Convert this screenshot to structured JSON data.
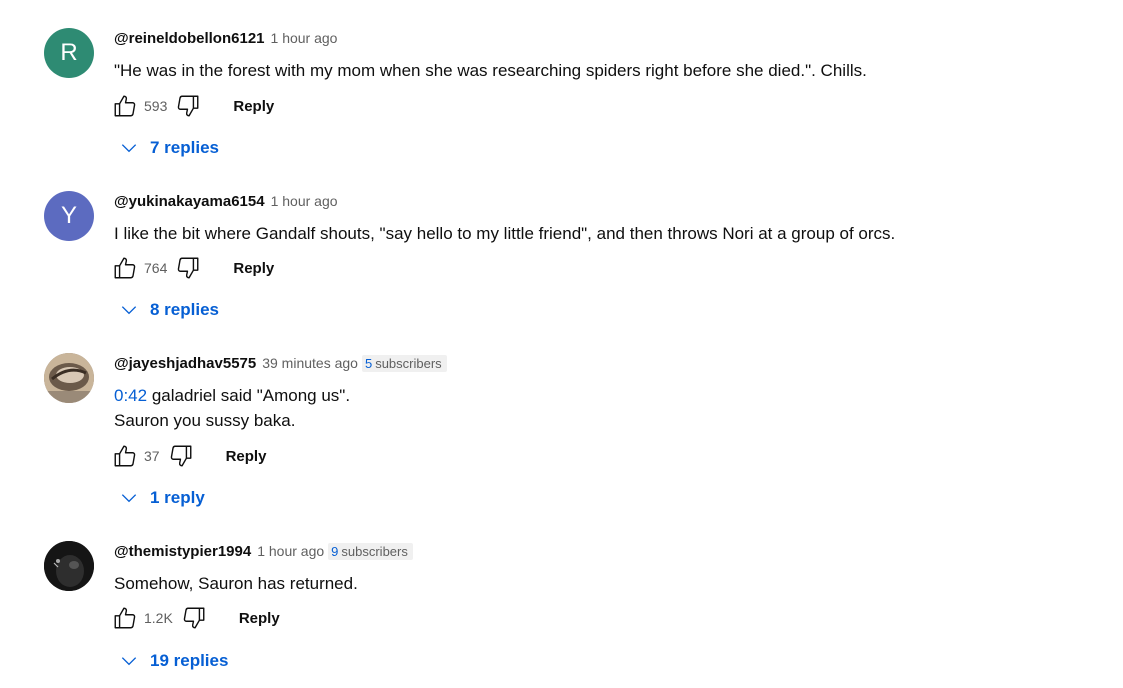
{
  "comments": [
    {
      "author": "@reineldobellon6121",
      "time": "1 hour ago",
      "avatar_letter": "R",
      "avatar_color": "#2e8b73",
      "text_lines": [
        "\"He was in the forest with my mom when she was researching spiders right before she died.\". Chills."
      ],
      "likes": "593",
      "reply_label": "Reply",
      "replies_label": "7 replies"
    },
    {
      "author": "@yukinakayama6154",
      "time": "1 hour ago",
      "avatar_letter": "Y",
      "avatar_color": "#5c6bc0",
      "text_lines": [
        "I like the bit where Gandalf shouts, \"say hello to my little friend\", and then throws Nori at a group of orcs."
      ],
      "likes": "764",
      "reply_label": "Reply",
      "replies_label": "8 replies"
    },
    {
      "author": "@jayeshjadhav5575",
      "time": "39 minutes ago",
      "subscribers_count": "5",
      "subscribers_label": "subscribers",
      "timestamp_link": "0:42",
      "text_after_timestamp": " galadriel said \"Among us\".",
      "text_line2": "Sauron you sussy baka.",
      "likes": "37",
      "reply_label": "Reply",
      "replies_label": "1 reply"
    },
    {
      "author": "@themistypier1994",
      "time": "1 hour ago",
      "subscribers_count": "9",
      "subscribers_label": "subscribers",
      "text_lines": [
        "Somehow, Sauron has returned."
      ],
      "likes": "1.2K",
      "reply_label": "Reply",
      "replies_label": "19 replies"
    }
  ],
  "colors": {
    "link_blue": "#065fd4",
    "secondary_text": "#606060"
  }
}
